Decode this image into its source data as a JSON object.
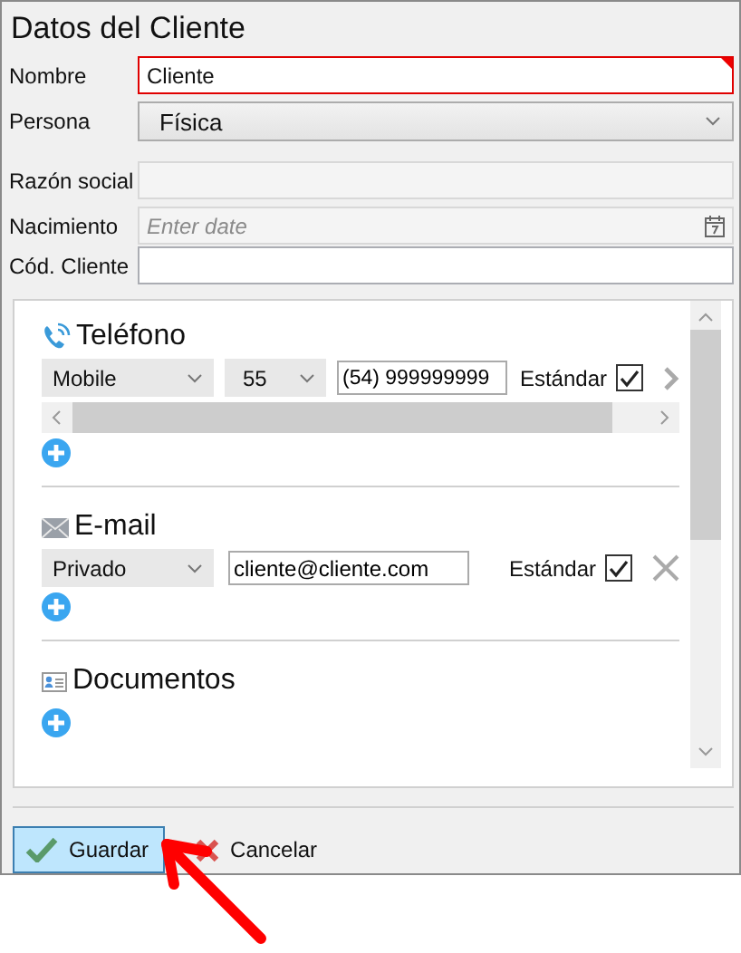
{
  "window": {
    "title": "Datos del Cliente"
  },
  "fields": [
    {
      "label": "Nombre",
      "kind": "text",
      "value": "Cliente",
      "invalid": true,
      "disabled": false
    },
    {
      "label": "Persona",
      "kind": "select",
      "value": "Física",
      "invalid": false,
      "disabled": false
    },
    {
      "label": "Razón social",
      "kind": "text",
      "invalid": false,
      "disabled": true
    },
    {
      "label": "Nacimiento",
      "kind": "date",
      "placeholder": "Enter date",
      "invalid": false,
      "disabled": false
    },
    {
      "label": "Cód. Cliente",
      "kind": "text",
      "invalid": false,
      "disabled": false
    }
  ],
  "sections": [
    {
      "kind": "phone",
      "title": "Teléfono",
      "entries": [
        {
          "type": "Mobile",
          "area_code": "55",
          "value": "(54) 999999999",
          "standard_label": "Estándar",
          "standard": true
        }
      ]
    },
    {
      "kind": "email",
      "title": "E-mail",
      "entries": [
        {
          "type": "Privado",
          "value": "cliente@cliente.com",
          "standard_label": "Estándar",
          "standard": true
        }
      ]
    },
    {
      "kind": "documents",
      "title": "Documentos"
    }
  ],
  "buttons": [
    {
      "label": "Guardar",
      "kind": "save",
      "highlighted": true
    },
    {
      "label": "Cancelar",
      "kind": "cancel",
      "highlighted": false
    }
  ]
}
